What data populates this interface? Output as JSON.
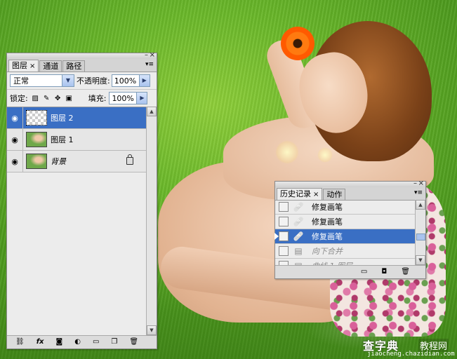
{
  "layers_panel": {
    "tabs": [
      {
        "label": "图层"
      },
      {
        "label": "通道"
      },
      {
        "label": "路径"
      }
    ],
    "close_glyph": "×",
    "minimize_glyph": "–",
    "close_panel_glyph": "×",
    "menu_glyph": "▾≡",
    "blend_mode": "正常",
    "opacity_label": "不透明度:",
    "opacity_value": "100%",
    "lock_label": "锁定:",
    "fill_label": "填充:",
    "fill_value": "100%",
    "layers": [
      {
        "name": "图层 2",
        "selected": true,
        "thumb": "transparent",
        "locked": false
      },
      {
        "name": "图层 1",
        "selected": false,
        "thumb": "image",
        "locked": false
      },
      {
        "name": "背景",
        "selected": false,
        "thumb": "image",
        "locked": true
      }
    ],
    "footer_icons": [
      "link-icon",
      "fx-icon",
      "mask-icon",
      "adjustment-icon",
      "folder-icon",
      "new-layer-icon",
      "trash-icon"
    ],
    "fx_label": "fx"
  },
  "history_panel": {
    "tabs": [
      {
        "label": "历史记录"
      },
      {
        "label": "动作"
      }
    ],
    "close_glyph": "×",
    "items": [
      {
        "label": "修复画笔",
        "state": "normal"
      },
      {
        "label": "修复画笔",
        "state": "normal"
      },
      {
        "label": "修复画笔",
        "state": "selected"
      },
      {
        "label": "向下合并",
        "state": "dimmed"
      },
      {
        "label": "曲线 1 图层",
        "state": "dimmed"
      }
    ],
    "footer_icons": [
      "new-document-icon",
      "snapshot-icon",
      "trash-icon"
    ]
  },
  "watermark": {
    "site": "查字典",
    "tag": "教程网",
    "url": "jiaocheng.chazidian.com"
  },
  "colors": {
    "selection": "#3a6fc4",
    "panel_bg": "#ececec"
  }
}
